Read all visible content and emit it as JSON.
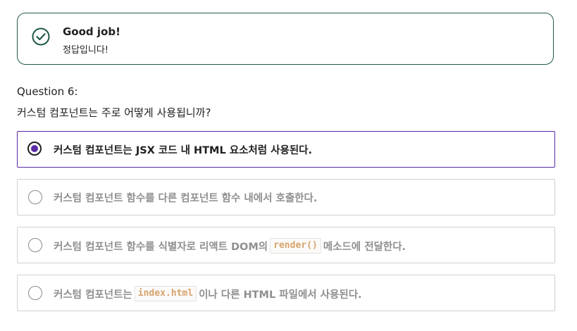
{
  "feedback": {
    "title": "Good job!",
    "message": "정답입니다!",
    "icon": "check-circle-icon",
    "border_color": "#1f5a45"
  },
  "question": {
    "label": "Question 6:",
    "text": "커스텀 컴포넌트는 주로 어떻게 사용됩니까?"
  },
  "options": [
    {
      "selected": true,
      "text": "커스텀 컴포넌트는 JSX 코드 내 HTML 요소처럼 사용된다."
    },
    {
      "selected": false,
      "text": "커스텀 컴포넌트 함수를 다른 컴포넌트 함수 내에서 호출한다."
    },
    {
      "selected": false,
      "text_before": "커스텀 컴포넌트 함수를 식별자로 리액트 DOM의",
      "code": "render()",
      "text_after": "메소드에 전달한다."
    },
    {
      "selected": false,
      "text_before": "커스텀 컴포넌트는",
      "code": "index.html",
      "text_after": "이나 다른 HTML 파일에서 사용된다."
    }
  ],
  "colors": {
    "accent": "#5b2aa6",
    "code_text": "#d8a36e",
    "muted_text": "#8f8f8f"
  }
}
